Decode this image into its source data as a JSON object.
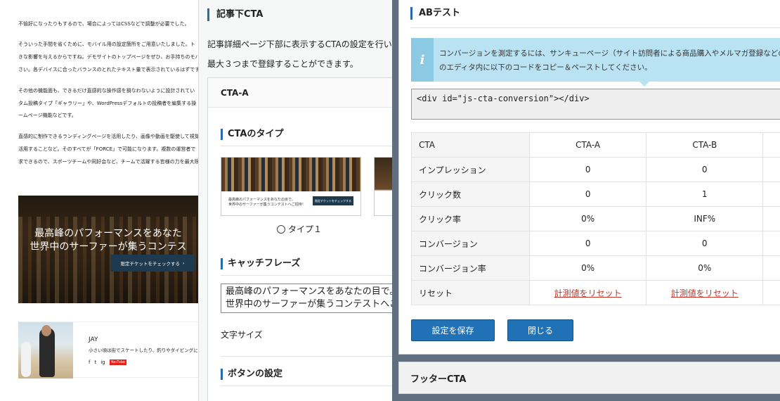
{
  "blog": {
    "paragraphs": [
      "不愉好になったりもするので、場合によってはCSSなどで調整が必要でした。",
      "そういった手間を省くために、モバイル用の設定箇所をご用意いたしました。ト",
      "きな影響を与えるからですね。デモサイトのトップページをぜひ、お手持ちのモバ",
      "さい。各デバイスに合ったバランスのとれたテキスト量で表示されているはずです",
      "その他の機能面も、できるだけ直感的な操作感を損なわないように設計されてい",
      "タム投稿タイプ「ギャラリー」や、WordPressデフォルトの投稿者を編集する操",
      "ームページ機能などです。",
      "直感的に制作できるランディングページを活用したり、画像や動画を駆使して視覚",
      "活用することなど。そのすべてが「FORCE」で可能になります。複数の運営者で",
      "求できるので、スポーツチームや同好会など、チームで活躍する皆様の力を最大限"
    ],
    "hero": {
      "line1": "最高峰のパフォーマンスをあなた",
      "line2": "世界中のサーファーが集うコンテス",
      "button": "限定チケットをチェックする",
      "button_icon": "chevron-right-icon"
    },
    "author": {
      "name": "JAY",
      "bio": "小さい頃は街でスケートしたり、釣りやダイビングにも",
      "social": [
        "f",
        "t",
        "ig",
        "YouTube"
      ]
    }
  },
  "cta_panel": {
    "title": "記事下CTA",
    "desc1": "記事詳細ページ下部に表示するCTAの設定を行いま",
    "desc2": "最大３つまで登録することができます。",
    "box_title": "CTA-A",
    "type_heading": "CTAのタイプ",
    "thumb_line1": "最高峰のパフォーマンスをあなたの目で。",
    "thumb_line2": "世界中のサーファーが集うコンテストへご招待！",
    "thumb_button": "限定チケットをチェックする",
    "type1_label": "タイプ１",
    "catch_heading": "キャッチフレーズ",
    "catch_line1": "最高峰のパフォーマンスをあなたの目で。",
    "catch_line2": "世界中のサーファーが集うコンテストへご",
    "font_size_label": "文字サイズ",
    "button_heading": "ボタンの設定"
  },
  "ab_test": {
    "title": "ABテスト",
    "notice_line1": "コンバージョンを測定するには、サンキューページ（サイト訪問者による商品購入やメルマガ登録などのアクシ",
    "notice_line2": "のエディタ内に以下のコードをコピー＆ペーストしてください。",
    "notice_icon": "info-icon",
    "code": "<div id=\"js-cta-conversion\"></div>",
    "table": {
      "header": [
        "CTA",
        "CTA-A",
        "CTA-B"
      ],
      "rows": [
        {
          "label": "インプレッション",
          "a": "0",
          "b": "0"
        },
        {
          "label": "クリック数",
          "a": "0",
          "b": "1"
        },
        {
          "label": "クリック率",
          "a": "0%",
          "b": "INF%"
        },
        {
          "label": "コンバージョン",
          "a": "0",
          "b": "0"
        },
        {
          "label": "コンバージョン率",
          "a": "0%",
          "b": "0%"
        },
        {
          "label": "リセット",
          "a": "計測値をリセット",
          "b": "計測値をリセット"
        }
      ]
    },
    "save_button": "設定を保存",
    "close_button": "閉じる",
    "footer_title": "フッターCTA"
  },
  "colors": {
    "accent": "#2a6aa8",
    "button": "#2071b5",
    "reset_link": "#c0392b",
    "notice_bg": "#b9e2f2",
    "overlay_bg": "#5f6f80"
  }
}
